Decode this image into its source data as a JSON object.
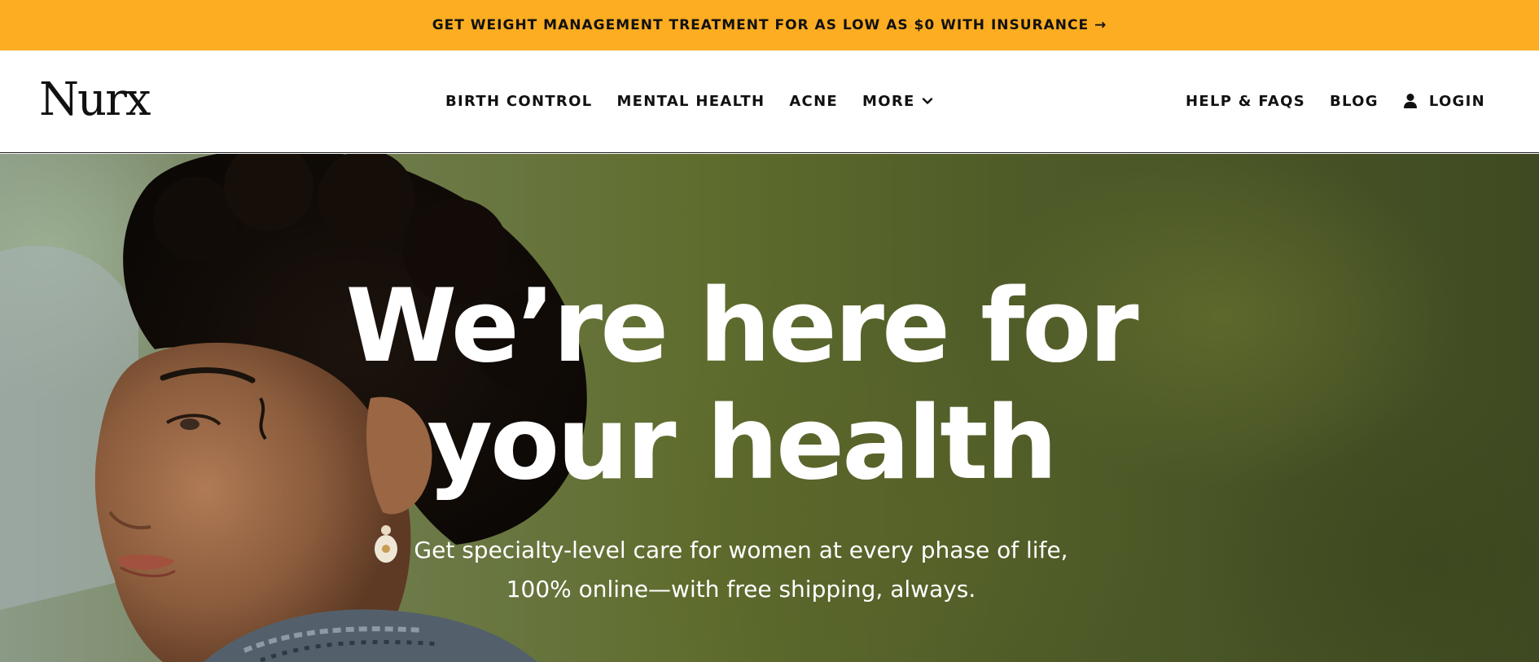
{
  "promo": {
    "text": "GET WEIGHT MANAGEMENT TREATMENT FOR AS LOW AS $0 WITH INSURANCE →"
  },
  "header": {
    "logo": "Nurx",
    "nav_center": [
      {
        "label": "BIRTH CONTROL"
      },
      {
        "label": "MENTAL HEALTH"
      },
      {
        "label": "ACNE"
      },
      {
        "label": "MORE",
        "icon": "chevron-down-icon"
      }
    ],
    "nav_right": [
      {
        "label": "HELP & FAQS"
      },
      {
        "label": "BLOG"
      },
      {
        "label": "LOGIN",
        "icon": "user-icon"
      }
    ]
  },
  "hero": {
    "title_line1": "We’re here for",
    "title_line2": "your health",
    "subtitle_line1": "Get specialty-level care for women at every phase of life,",
    "subtitle_line2": "100% online—with free shipping, always."
  },
  "colors": {
    "promo_bg": "#fdad22",
    "text_dark": "#111111",
    "hero_text": "#ffffff"
  }
}
